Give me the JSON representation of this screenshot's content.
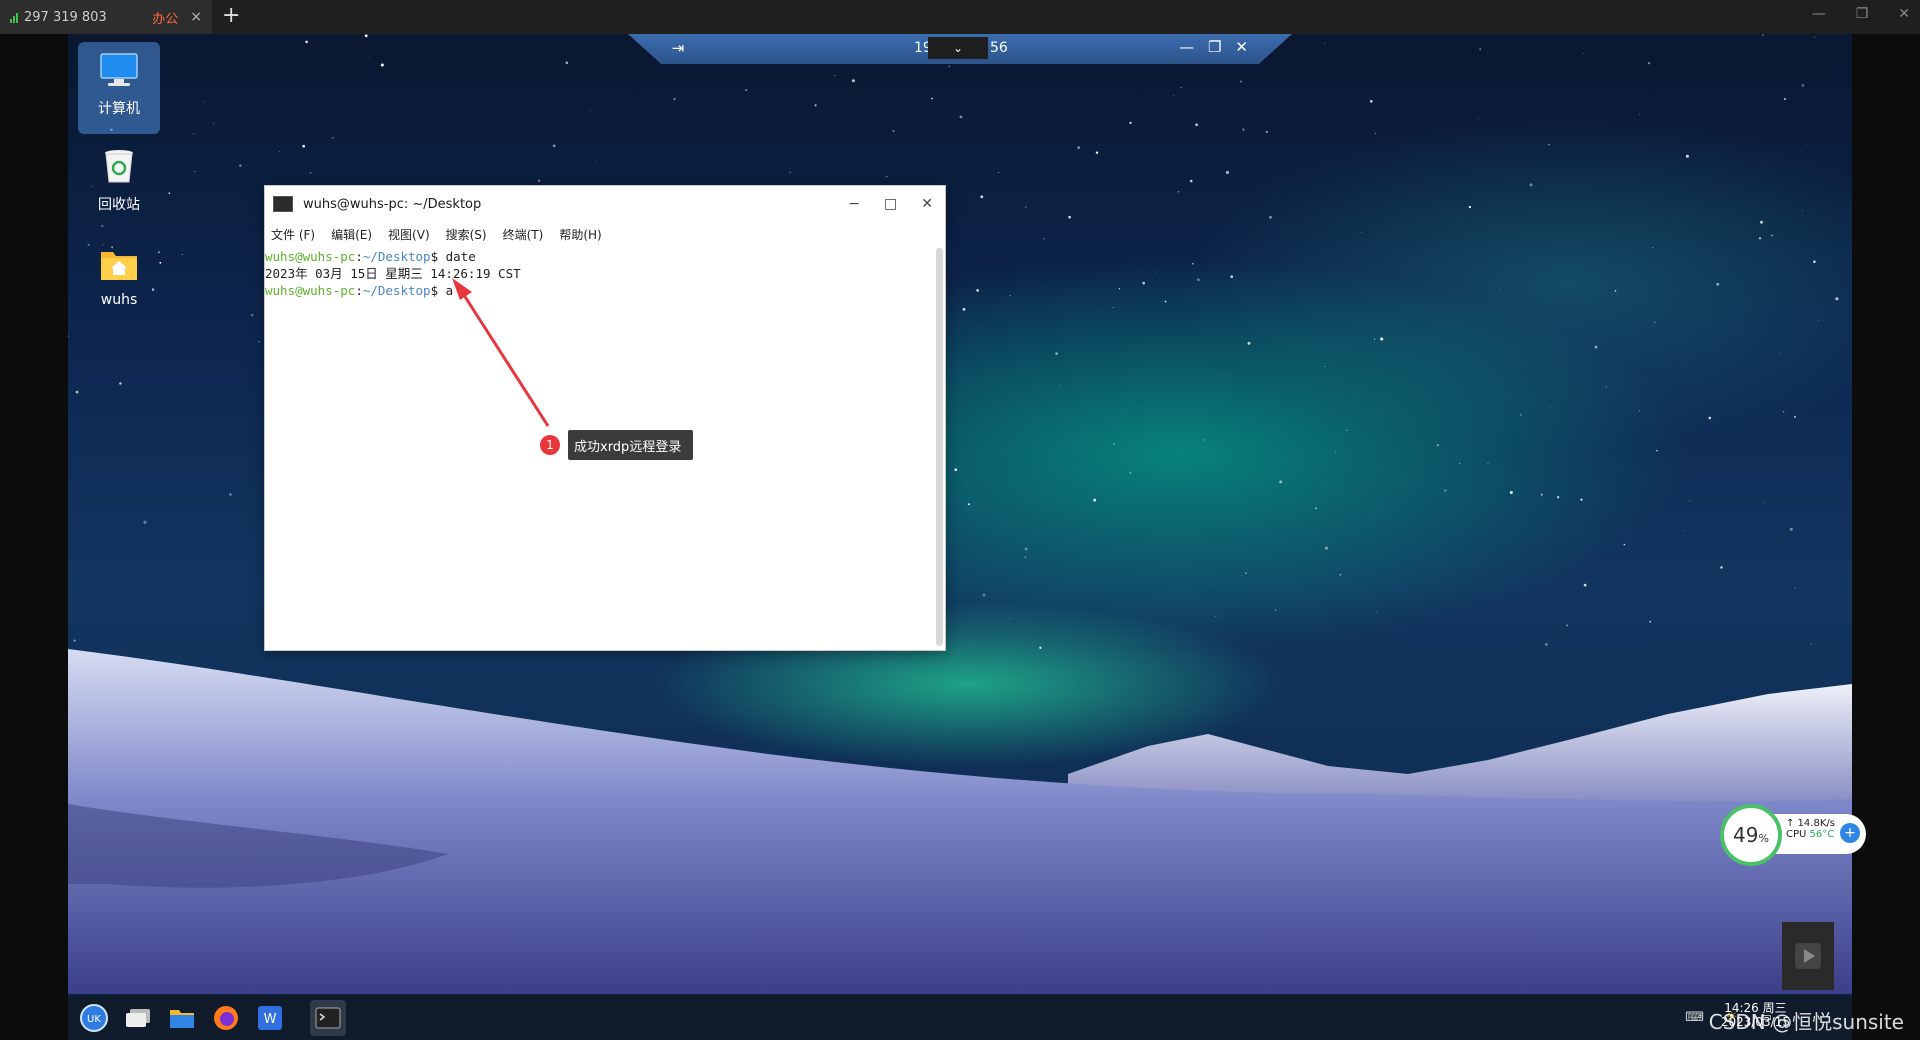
{
  "client": {
    "tab_signal": "297 319 803",
    "tab_name": "办公",
    "tab_close": "×",
    "new_tab": "+",
    "minimize": "—",
    "restore": "❐",
    "close": "✕"
  },
  "connection_bar": {
    "id_left": "19",
    "id_right": "56",
    "dropdown": "⌄",
    "pin": "⇥",
    "minimize": "—",
    "restore": "❐",
    "close": "✕"
  },
  "desktop_icons": [
    {
      "label": "计算机",
      "icon": "computer-icon",
      "selected": true
    },
    {
      "label": "回收站",
      "icon": "recycle-bin-icon",
      "selected": false
    },
    {
      "label": "wuhs",
      "icon": "home-folder-icon",
      "selected": false
    }
  ],
  "terminal": {
    "title": "wuhs@wuhs-pc: ~/Desktop",
    "menu": [
      "文件 (F)",
      "编辑(E)",
      "视图(V)",
      "搜索(S)",
      "终端(T)",
      "帮助(H)"
    ],
    "prompt_user": "wuhs@wuhs-pc",
    "prompt_sep": ":",
    "prompt_path": "~/Desktop",
    "prompt_end": "$",
    "command": " date",
    "output": "2023年 03月 15日 星期三 14:26:19 CST",
    "command2": " a",
    "minimize": "−",
    "maximize": "□",
    "close": "✕"
  },
  "annotation": {
    "number": "1",
    "text": "成功xrdp远程登录"
  },
  "monitor_widget": {
    "percent": "49",
    "percent_unit": "%",
    "net_speed": "↑ 14.8K/s",
    "cpu_label": "CPU",
    "cpu_temp": "56°C",
    "plus": "+"
  },
  "taskbar": {
    "apps": [
      "launcher-icon",
      "multitask-icon",
      "file-manager-icon",
      "firefox-icon",
      "wps-writer-icon",
      "terminal-icon"
    ],
    "clock_time": "14:26 周三",
    "clock_date": "2023/03/15"
  },
  "watermark": "CSDN @恒悦sunsite",
  "colors": {
    "prompt_user": "#5fb32a",
    "prompt_path": "#4d85c3",
    "tab_app": "#ff6a3d",
    "annotation_red": "#e8363d"
  }
}
